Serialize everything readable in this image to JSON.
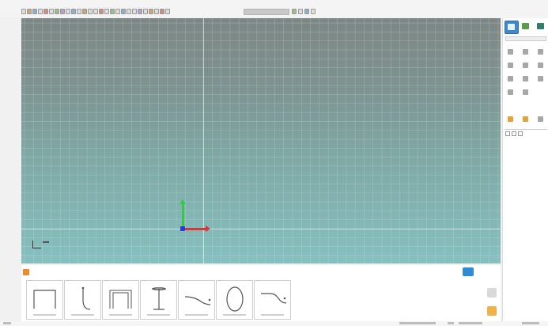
{
  "toolbar": {
    "icons": [
      "new-icon",
      "open-icon",
      "save-icon",
      "print-icon",
      "undo-icon",
      "redo-icon",
      "cut-icon",
      "copy-icon",
      "paste-icon",
      "select-icon",
      "move-icon",
      "rotate-icon",
      "scale-icon",
      "line-icon",
      "arc-icon",
      "rect-icon",
      "circle-icon",
      "text-icon",
      "layer-icon",
      "view-icon",
      "zoom-icon",
      "pan-icon",
      "render-icon",
      "grid-icon",
      "snap-icon",
      "measure-icon",
      "help-icon"
    ],
    "search_placeholder": ""
  },
  "viewport": {
    "background_top": "#7d8785",
    "background_bottom": "#86c0bf",
    "axis_colors": {
      "x": "#d8383a",
      "y": "#35c94a",
      "origin": "#2b3bd6"
    }
  },
  "right_panel": {
    "active_tab_color": "#3f89c9",
    "tabs": [
      "modeling-tab-icon",
      "material-tab-icon",
      "library-tab-icon"
    ]
  },
  "bottom_panel": {
    "palette_items": [
      {
        "shape": "rect-open"
      },
      {
        "shape": "hook"
      },
      {
        "shape": "rect-open-2"
      },
      {
        "shape": "i-beam"
      },
      {
        "shape": "curve"
      },
      {
        "shape": "oval"
      },
      {
        "shape": "curve-2"
      }
    ]
  },
  "colors": {
    "accent": "#2f8bd6",
    "orange": "#ef8a2c"
  }
}
